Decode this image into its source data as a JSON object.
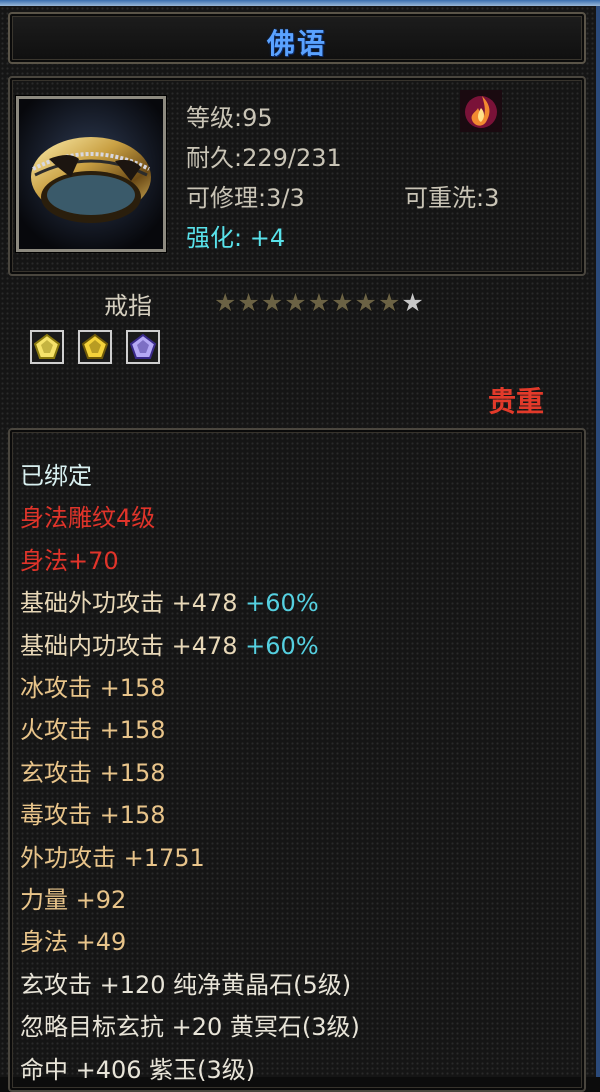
{
  "title": "佛语",
  "stats": {
    "level": {
      "label": "等级",
      "value": ":95"
    },
    "durability": {
      "label": "耐久",
      "value": ":229/231"
    },
    "repairable": {
      "label": "可修理",
      "value": ":3/3"
    },
    "rewashable": {
      "label": "可重洗",
      "value": ":3"
    },
    "enhance": {
      "label": "强化",
      "value": ": +4"
    }
  },
  "item_type": "戒指",
  "stars": {
    "filled": 8,
    "total": 9
  },
  "gems": [
    "yellow-crystal-icon",
    "yellow-ore-icon",
    "purple-jade-icon"
  ],
  "rarity": "贵重",
  "attributes": [
    {
      "text": "已绑定",
      "color": "#d8f0f0"
    },
    {
      "text": "身法雕纹4级",
      "color": "#e0342a"
    },
    {
      "text": "身法+70",
      "color": "#e0342a"
    },
    {
      "text": "基础外功攻击 +478",
      "pct": "+60%",
      "color": "#e8d8b8"
    },
    {
      "text": "基础内功攻击 +478",
      "pct": "+60%",
      "color": "#e8d8b8"
    },
    {
      "text": "冰攻击 +158",
      "color": "#e8c48a"
    },
    {
      "text": "火攻击 +158",
      "color": "#e8c48a"
    },
    {
      "text": "玄攻击 +158",
      "color": "#e8c48a"
    },
    {
      "text": "毒攻击 +158",
      "color": "#e8c48a"
    },
    {
      "text": "外功攻击 +1751",
      "color": "#e8c48a"
    },
    {
      "text": "力量 +92",
      "color": "#e8c48a"
    },
    {
      "text": "身法 +49",
      "color": "#e8c48a"
    },
    {
      "text": "玄攻击 +120 纯净黄晶石(5级)",
      "color": "#e8e4d8"
    },
    {
      "text": "忽略目标玄抗 +20 黄冥石(3级)",
      "color": "#e8e4d8"
    },
    {
      "text": "命中 +406 紫玉(3级)",
      "color": "#e8e4d8"
    }
  ]
}
